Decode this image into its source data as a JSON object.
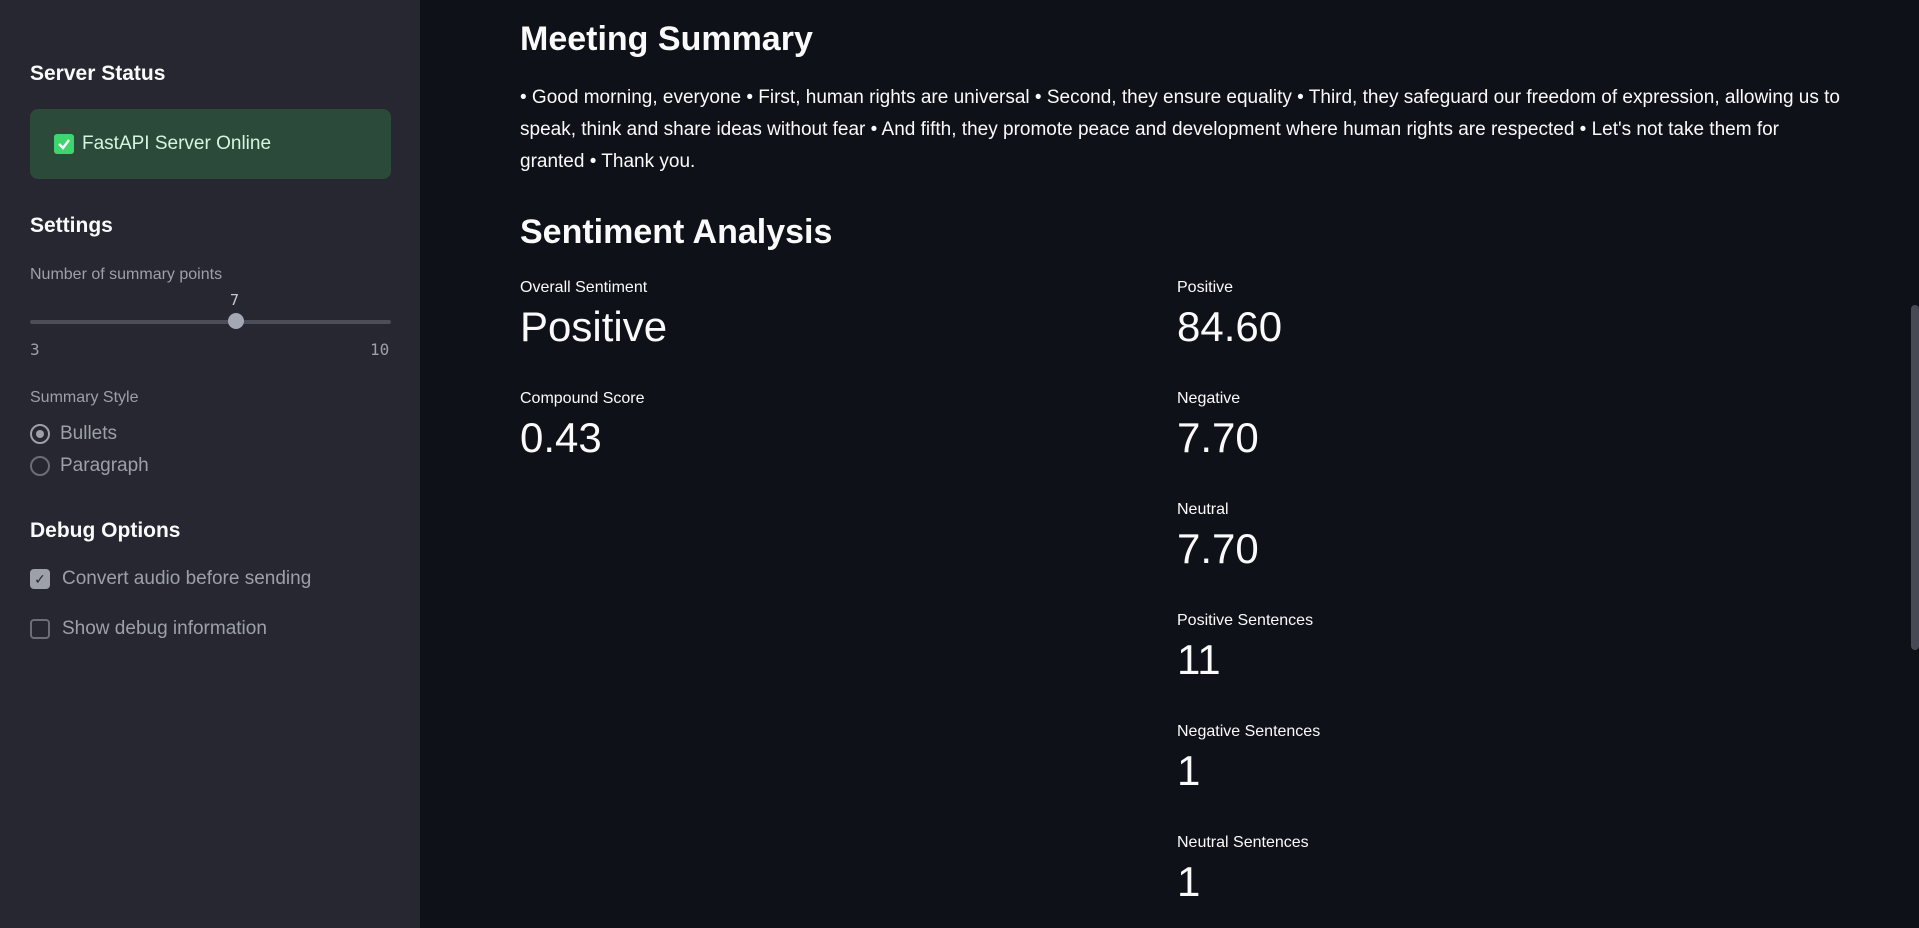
{
  "sidebar": {
    "server_status_heading": "Server Status",
    "server_status_text": "FastAPI Server Online",
    "settings_heading": "Settings",
    "slider": {
      "label": "Number of summary points",
      "value": "7",
      "min": "3",
      "max": "10"
    },
    "summary_style": {
      "label": "Summary Style",
      "options": [
        "Bullets",
        "Paragraph"
      ],
      "selected": "Bullets"
    },
    "debug_heading": "Debug Options",
    "debug_options": [
      {
        "label": "Convert audio before sending",
        "checked": true
      },
      {
        "label": "Show debug information",
        "checked": false
      }
    ]
  },
  "main": {
    "summary_heading": "Meeting Summary",
    "summary_text": "• Good morning, everyone • First, human rights are universal • Second, they ensure equality • Third, they safeguard our freedom of expression, allowing us to speak, think and share ideas without fear • And fifth, they promote peace and development where human rights are respected • Let's not take them for granted • Thank you.",
    "sentiment_heading": "Sentiment Analysis",
    "left_metrics": [
      {
        "label": "Overall Sentiment",
        "value": "Positive"
      },
      {
        "label": "Compound Score",
        "value": "0.43"
      }
    ],
    "right_metrics": [
      {
        "label": "Positive",
        "value": "84.60"
      },
      {
        "label": "Negative",
        "value": "7.70"
      },
      {
        "label": "Neutral",
        "value": "7.70"
      },
      {
        "label": "Positive Sentences",
        "value": "11"
      },
      {
        "label": "Negative Sentences",
        "value": "1"
      },
      {
        "label": "Neutral Sentences",
        "value": "1"
      }
    ]
  },
  "colors": {
    "sidebar_bg": "#262730",
    "main_bg": "#0e1117",
    "status_success_bg": "#2b4a3a",
    "success_check": "#3dd56d"
  }
}
